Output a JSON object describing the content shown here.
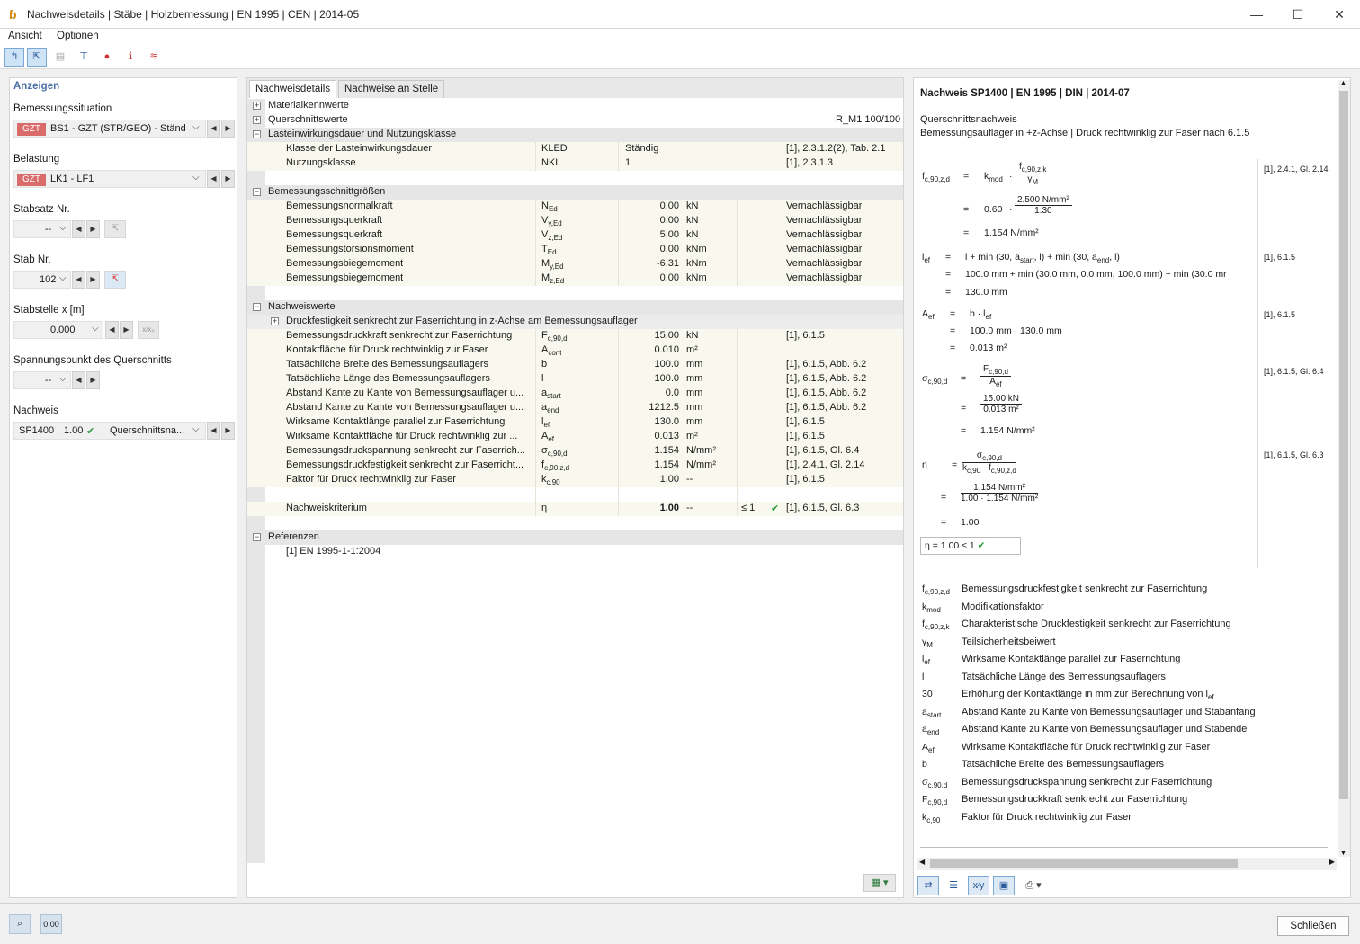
{
  "window": {
    "title": "Nachweisdetails | Stäbe | Holzbemessung | EN 1995 | CEN | 2014-05",
    "minimize": "—",
    "maximize": "☐",
    "close": "✕"
  },
  "menu": {
    "view": "Ansicht",
    "options": "Optionen"
  },
  "left": {
    "heading": "Anzeigen",
    "design_situation_label": "Bemessungssituation",
    "design_situation_badge": "GZT",
    "design_situation_value": "BS1 - GZT (STR/GEO) - Ständ...",
    "loading_label": "Belastung",
    "loading_badge": "GZT",
    "loading_value": "LK1 - LF1",
    "member_set_label": "Stabsatz Nr.",
    "member_set_value": "--",
    "member_label": "Stab Nr.",
    "member_value": "102",
    "location_label": "Stabstelle x [m]",
    "location_value": "0.000",
    "location_btn": "x/x₀",
    "stress_point_label": "Spannungspunkt des Querschnitts",
    "stress_point_value": "--",
    "check_label": "Nachweis",
    "check_id": "SP1400",
    "check_ratio": "1.00",
    "check_type": "Querschnittsna..."
  },
  "middle": {
    "tabs": [
      "Nachweisdetails",
      "Nachweise an Stelle"
    ],
    "groups": {
      "material": "Materialkennwerte",
      "section": "Querschnittswerte",
      "section_value": "R_M1 100/100",
      "load_duration": "Lasteinwirkungsdauer und Nutzungsklasse",
      "internal_forces": "Bemessungsschnittgrößen",
      "check_values": "Nachweiswerte",
      "check_subgroup": "Druckfestigkeit senkrecht zur Faserrichtung in z-Achse am Bemessungsauflager",
      "references": "Referenzen"
    },
    "load_rows": [
      {
        "name": "Klasse der Lasteinwirkungsdauer",
        "sym": "KLED",
        "val": "Ständig",
        "ref": "[1], 2.3.1.2(2), Tab. 2.1"
      },
      {
        "name": "Nutzungsklasse",
        "sym": "NKL",
        "val": "1",
        "ref": "[1], 2.3.1.3"
      }
    ],
    "force_rows": [
      {
        "name": "Bemessungsnormalkraft",
        "sym": "N",
        "sub": "Ed",
        "val": "0.00",
        "unit": "kN",
        "ref": "Vernachlässigbar"
      },
      {
        "name": "Bemessungsquerkraft",
        "sym": "V",
        "sub": "y,Ed",
        "val": "0.00",
        "unit": "kN",
        "ref": "Vernachlässigbar"
      },
      {
        "name": "Bemessungsquerkraft",
        "sym": "V",
        "sub": "z,Ed",
        "val": "5.00",
        "unit": "kN",
        "ref": "Vernachlässigbar"
      },
      {
        "name": "Bemessungstorsionsmoment",
        "sym": "T",
        "sub": "Ed",
        "val": "0.00",
        "unit": "kNm",
        "ref": "Vernachlässigbar"
      },
      {
        "name": "Bemessungsbiegemoment",
        "sym": "M",
        "sub": "y,Ed",
        "val": "-6.31",
        "unit": "kNm",
        "ref": "Vernachlässigbar"
      },
      {
        "name": "Bemessungsbiegemoment",
        "sym": "M",
        "sub": "z,Ed",
        "val": "0.00",
        "unit": "kNm",
        "ref": "Vernachlässigbar"
      }
    ],
    "check_rows": [
      {
        "name": "Bemessungsdruckkraft senkrecht zur Faserrichtung",
        "sym": "F",
        "sub": "c,90,d",
        "val": "15.00",
        "unit": "kN",
        "ref": "[1], 6.1.5"
      },
      {
        "name": "Kontaktfläche für Druck rechtwinklig zur Faser",
        "sym": "A",
        "sub": "cont",
        "val": "0.010",
        "unit": "m²",
        "ref": ""
      },
      {
        "name": "Tatsächliche Breite des Bemessungsauflagers",
        "sym": "b",
        "sub": "",
        "val": "100.0",
        "unit": "mm",
        "ref": "[1], 6.1.5, Abb. 6.2"
      },
      {
        "name": "Tatsächliche Länge des Bemessungsauflagers",
        "sym": "l",
        "sub": "",
        "val": "100.0",
        "unit": "mm",
        "ref": "[1], 6.1.5, Abb. 6.2"
      },
      {
        "name": "Abstand Kante zu Kante von Bemessungsauflager u...",
        "sym": "a",
        "sub": "start",
        "val": "0.0",
        "unit": "mm",
        "ref": "[1], 6.1.5, Abb. 6.2"
      },
      {
        "name": "Abstand Kante zu Kante von Bemessungsauflager u...",
        "sym": "a",
        "sub": "end",
        "val": "1212.5",
        "unit": "mm",
        "ref": "[1], 6.1.5, Abb. 6.2"
      },
      {
        "name": "Wirksame Kontaktlänge parallel zur Faserrichtung",
        "sym": "l",
        "sub": "ef",
        "val": "130.0",
        "unit": "mm",
        "ref": "[1], 6.1.5"
      },
      {
        "name": "Wirksame Kontaktfläche für Druck rechtwinklig zur ...",
        "sym": "A",
        "sub": "ef",
        "val": "0.013",
        "unit": "m²",
        "ref": "[1], 6.1.5"
      },
      {
        "name": "Bemessungsdruckspannung senkrecht zur Faserrich...",
        "sym": "σ",
        "sub": "c,90,d",
        "val": "1.154",
        "unit": "N/mm²",
        "ref": "[1], 6.1.5, Gl. 6.4"
      },
      {
        "name": "Bemessungsdruckfestigkeit senkrecht zur Faserricht...",
        "sym": "f",
        "sub": "c,90,z,d",
        "val": "1.154",
        "unit": "N/mm²",
        "ref": "[1], 2.4.1, Gl. 2.14"
      },
      {
        "name": "Faktor für Druck rechtwinklig zur Faser",
        "sym": "k",
        "sub": "c,90",
        "val": "1.00",
        "unit": "--",
        "ref": "[1], 6.1.5"
      }
    ],
    "criterion": {
      "name": "Nachweiskriterium",
      "sym": "η",
      "val": "1.00",
      "unit": "--",
      "limit": "≤ 1",
      "ok": "✔",
      "ref": "[1], 6.1.5, Gl. 6.3"
    },
    "reference_item": "[1]  EN 1995-1-1:2004"
  },
  "right": {
    "title": "Nachweis SP1400 | EN 1995 | DIN | 2014-07",
    "subtitle1": "Querschnittsnachweis",
    "subtitle2": "Bemessungsauflager in +z-Achse | Druck rechtwinklig zur Faser nach 6.1.5",
    "refs": [
      "[1], 2.4.1, Gl. 2.14",
      "[1], 6.1.5",
      "[1], 6.1.5",
      "[1], 6.1.5, Gl. 6.4",
      "[1], 6.1.5, Gl. 6.3"
    ],
    "eq_fc_lhs": "f",
    "eq_fc_lhs_sub": "c,90,z,d",
    "eq_fc_kmod": "k",
    "eq_fc_kmod_sub": "mod",
    "eq_fc_num": "f",
    "eq_fc_num_sub": "c,90,z,k",
    "eq_fc_den": "γ",
    "eq_fc_den_sub": "M",
    "eq_fc_l2_factor": "0.60",
    "eq_fc_l2_num": "2.500 N/mm²",
    "eq_fc_l2_den": "1.30",
    "eq_fc_result": "1.154 N/mm²",
    "eq_lef_lhs": "l",
    "eq_lef_lhs_sub": "ef",
    "eq_lef_l1": "l  +  min (30,  a",
    "eq_lef_l1_sub1": "start",
    "eq_lef_l1_mid": ",  l)  +  min (30,  a",
    "eq_lef_l1_sub2": "end",
    "eq_lef_l1_end": ",  l)",
    "eq_lef_l2": "100.0 mm  +  min (30.0 mm,  0.0 mm,  100.0 mm)  +  min (30.0 mr",
    "eq_lef_l3": "130.0 mm",
    "eq_aef_lhs": "A",
    "eq_aef_lhs_sub": "ef",
    "eq_aef_l1": "b  ·  l",
    "eq_aef_l1_sub": "ef",
    "eq_aef_l2": "100.0 mm  ·  130.0 mm",
    "eq_aef_l3": "0.013 m²",
    "eq_sig_lhs": "σ",
    "eq_sig_lhs_sub": "c,90,d",
    "eq_sig_num": "F",
    "eq_sig_num_sub": "c,90,d",
    "eq_sig_den": "A",
    "eq_sig_den_sub": "ef",
    "eq_sig_l2_num": "15.00 kN",
    "eq_sig_l2_den": "0.013 m²",
    "eq_sig_l3": "1.154 N/mm²",
    "eq_eta_lhs": "η",
    "eq_eta_num": "σ",
    "eq_eta_num_sub": "c,90,d",
    "eq_eta_den1": "k",
    "eq_eta_den1_sub": "c,90",
    "eq_eta_den_mid": "  ·  f",
    "eq_eta_den2_sub": "c,90,z,d",
    "eq_eta_l2_num": "1.154 N/mm²",
    "eq_eta_l2_den": "1.00  ·  1.154 N/mm²",
    "eq_eta_l3": "1.00",
    "eq_eta_box": "η    =    1.00  ≤ 1",
    "eq_op_equal": "=",
    "eq_op_dot": "·",
    "legend": [
      {
        "sym": "f",
        "sub": "c,90,z,d",
        "txt": "Bemessungsdruckfestigkeit senkrecht zur Faserrichtung"
      },
      {
        "sym": "k",
        "sub": "mod",
        "txt": "Modifikationsfaktor"
      },
      {
        "sym": "f",
        "sub": "c,90,z,k",
        "txt": "Charakteristische Druckfestigkeit senkrecht zur Faserrichtung"
      },
      {
        "sym": "γ",
        "sub": "M",
        "txt": "Teilsicherheitsbeiwert"
      },
      {
        "sym": "l",
        "sub": "ef",
        "txt": "Wirksame Kontaktlänge parallel zur Faserrichtung"
      },
      {
        "sym": "l",
        "sub": "",
        "txt": "Tatsächliche Länge des Bemessungsauflagers"
      },
      {
        "sym": "30",
        "sub": "",
        "txt": "Erhöhung der Kontaktlänge in mm zur Berechnung von l"
      },
      {
        "sym": "a",
        "sub": "start",
        "txt": "Abstand Kante zu Kante von Bemessungsauflager und Stabanfang"
      },
      {
        "sym": "a",
        "sub": "end",
        "txt": "Abstand Kante zu Kante von Bemessungsauflager und Stabende"
      },
      {
        "sym": "A",
        "sub": "ef",
        "txt": "Wirksame Kontaktfläche für Druck rechtwinklig zur Faser"
      },
      {
        "sym": "b",
        "sub": "",
        "txt": "Tatsächliche Breite des Bemessungsauflagers"
      },
      {
        "sym": "σ",
        "sub": "c,90,d",
        "txt": "Bemessungsdruckspannung senkrecht zur Faserrichtung"
      },
      {
        "sym": "F",
        "sub": "c,90,d",
        "txt": "Bemessungsdruckkraft senkrecht zur Faserrichtung"
      },
      {
        "sym": "k",
        "sub": "c,90",
        "txt": "Faktor für Druck rechtwinklig zur Faser"
      }
    ],
    "legend_lef_sub": "ef"
  },
  "footer": {
    "close_label": "Schließen",
    "units_icon": "0,00"
  }
}
